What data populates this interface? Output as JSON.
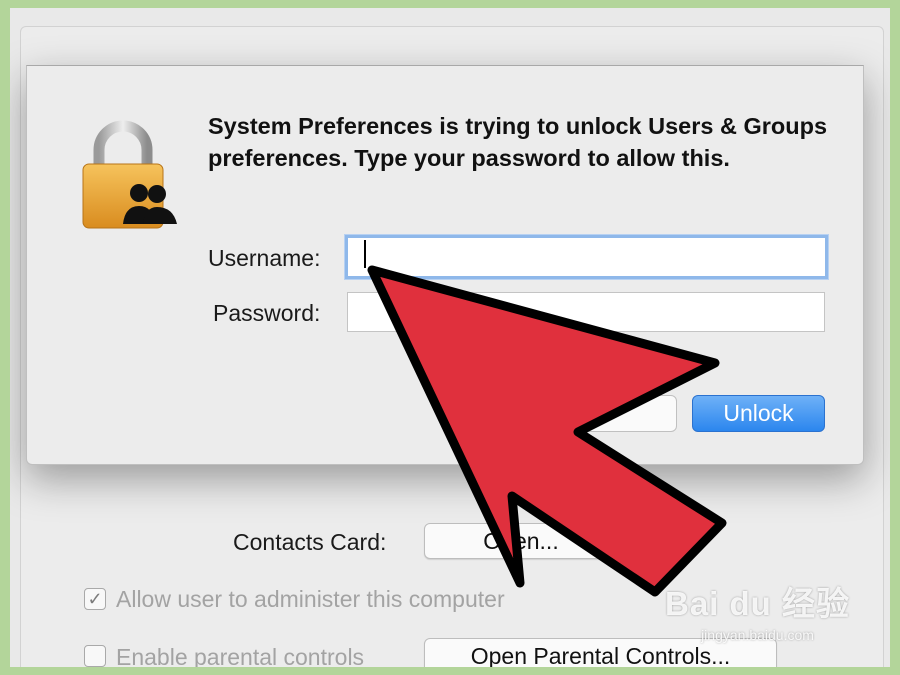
{
  "dialog": {
    "message": "System Preferences is trying to unlock Users & Groups preferences. Type your password to allow this.",
    "username_label": "Username:",
    "username_value": "",
    "password_label": "Password:",
    "password_value": "",
    "unlock_label": "Unlock",
    "lock_icon": "lock-with-users-icon"
  },
  "background": {
    "contacts_card_label": "Contacts Card:",
    "open_button_label": "Open...",
    "allow_admin_label": "Allow user to administer this computer",
    "allow_admin_checked": true,
    "parental_label": "Enable parental controls",
    "parental_checked": false,
    "open_parental_button_label": "Open Parental Controls..."
  },
  "overlay": {
    "arrow_icon": "red-pointer-arrow-icon",
    "arrow_color": "#e0303d"
  },
  "watermark": {
    "main": "Bai du 经验",
    "sub": "jingyan.baidu.com"
  }
}
